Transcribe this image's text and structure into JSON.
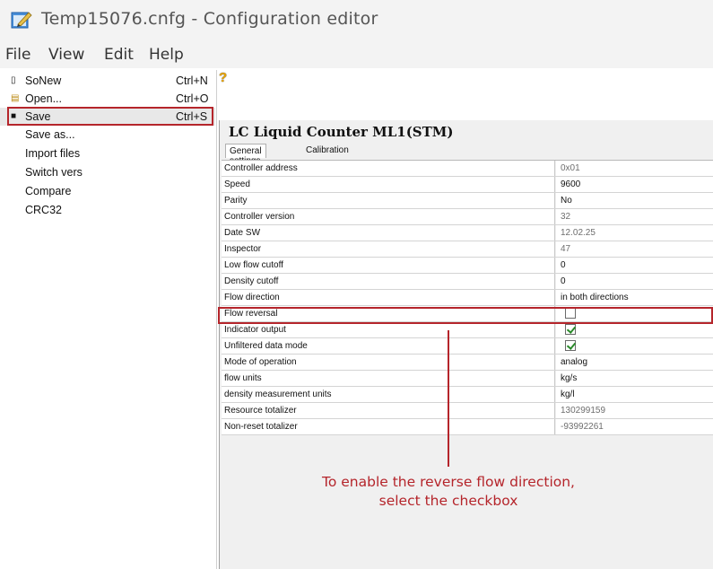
{
  "window": {
    "title": "Temp15076.cnfg - Configuration editor",
    "icon": "config-editor-app-icon"
  },
  "menubar": {
    "items": [
      "File",
      "View",
      "Edit",
      "Help"
    ]
  },
  "file_menu": {
    "items": [
      {
        "label": "SoNew",
        "shortcut": "Ctrl+N",
        "icon": "new-document-icon"
      },
      {
        "label": "Open...",
        "shortcut": "Ctrl+O",
        "icon": "folder-open-icon"
      },
      {
        "label": "Save",
        "shortcut": "Ctrl+S",
        "icon": "floppy-disk-icon"
      },
      {
        "label": "Save as...",
        "shortcut": ""
      },
      {
        "label": "Import files",
        "shortcut": ""
      },
      {
        "label": "Switch vers",
        "shortcut": ""
      },
      {
        "label": "Compare",
        "shortcut": ""
      },
      {
        "label": "CRC32",
        "shortcut": ""
      }
    ],
    "highlighted": "Save"
  },
  "toolbar": {
    "help_icon": "help-question-icon"
  },
  "panel": {
    "title": "LC Liquid Counter ML1(STM)",
    "tabs": [
      "General settings",
      "Calibration"
    ],
    "active_tab": "General settings",
    "rows": [
      {
        "name": "Controller address",
        "value": "0x01",
        "readonly": true
      },
      {
        "name": "Speed",
        "value": "9600",
        "readonly": false
      },
      {
        "name": "Parity",
        "value": "No",
        "readonly": false
      },
      {
        "name": "Controller version",
        "value": "32",
        "readonly": true
      },
      {
        "name": "Date SW",
        "value": "12.02.25",
        "readonly": true
      },
      {
        "name": "Inspector",
        "value": "47",
        "readonly": true
      },
      {
        "name": "Low flow cutoff",
        "value": "0",
        "readonly": false
      },
      {
        "name": "Density cutoff",
        "value": "0",
        "readonly": false
      },
      {
        "name": "Flow direction",
        "value": "in both directions",
        "readonly": false
      },
      {
        "name": "Flow reversal",
        "checkbox": true,
        "checked": false
      },
      {
        "name": "Indicator output",
        "checkbox": true,
        "checked": true
      },
      {
        "name": "Unfiltered data mode",
        "checkbox": true,
        "checked": true
      },
      {
        "name": "Mode of operation",
        "value": "analog",
        "readonly": false
      },
      {
        "name": "flow units",
        "value": "kg/s",
        "readonly": false
      },
      {
        "name": "density measurement units",
        "value": "kg/l",
        "readonly": false
      },
      {
        "name": "Resource totalizer",
        "value": "130299159",
        "readonly": true
      },
      {
        "name": "Non-reset totalizer",
        "value": "-93992261",
        "readonly": true
      }
    ]
  },
  "annotation": {
    "line1": "To enable the reverse flow direction,",
    "line2": "select the checkbox",
    "color": "#b5252b"
  }
}
